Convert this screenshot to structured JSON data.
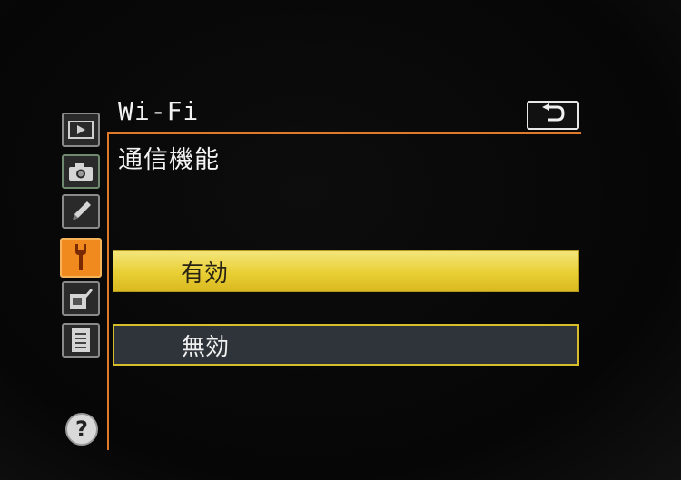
{
  "menu": {
    "title": "Wi-Fi"
  },
  "item": {
    "title": "通信機能"
  },
  "options": [
    {
      "label": "有効",
      "selected": true
    },
    {
      "label": "無効",
      "selected": false
    }
  ],
  "help": {
    "label": "?"
  },
  "colors": {
    "accent_orange": "#f08a1e",
    "highlight_yellow": "#e9cf33",
    "option_dark": "#2e3439"
  },
  "icons": {
    "tabs": [
      "playback-icon",
      "camera-icon",
      "pencil-icon",
      "wrench-icon",
      "retouch-icon",
      "my-menu-icon"
    ],
    "back": "back-arrow-icon"
  }
}
